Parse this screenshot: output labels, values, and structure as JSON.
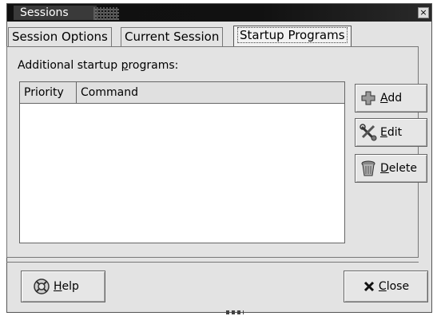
{
  "window": {
    "title": "Sessions",
    "close_glyph": "×"
  },
  "tabs": [
    {
      "label": "Session Options"
    },
    {
      "label": "Current Session"
    },
    {
      "label": "Startup Programs"
    }
  ],
  "section": {
    "label_pre": "Additional startup ",
    "label_mn": "p",
    "label_post": "rograms:"
  },
  "list": {
    "columns": [
      {
        "label": "Priority"
      },
      {
        "label": "Command"
      }
    ],
    "rows": []
  },
  "buttons": {
    "add": {
      "mn": "A",
      "rest": "dd",
      "icon": "plus-icon"
    },
    "edit": {
      "mn": "E",
      "rest": "dit",
      "icon": "tools-icon"
    },
    "delete": {
      "mn": "D",
      "rest": "elete",
      "icon": "trash-icon"
    },
    "help": {
      "mn": "H",
      "rest": "elp",
      "icon": "lifebuoy-icon"
    },
    "close": {
      "mn": "C",
      "rest": "lose",
      "icon": "x-icon"
    }
  }
}
